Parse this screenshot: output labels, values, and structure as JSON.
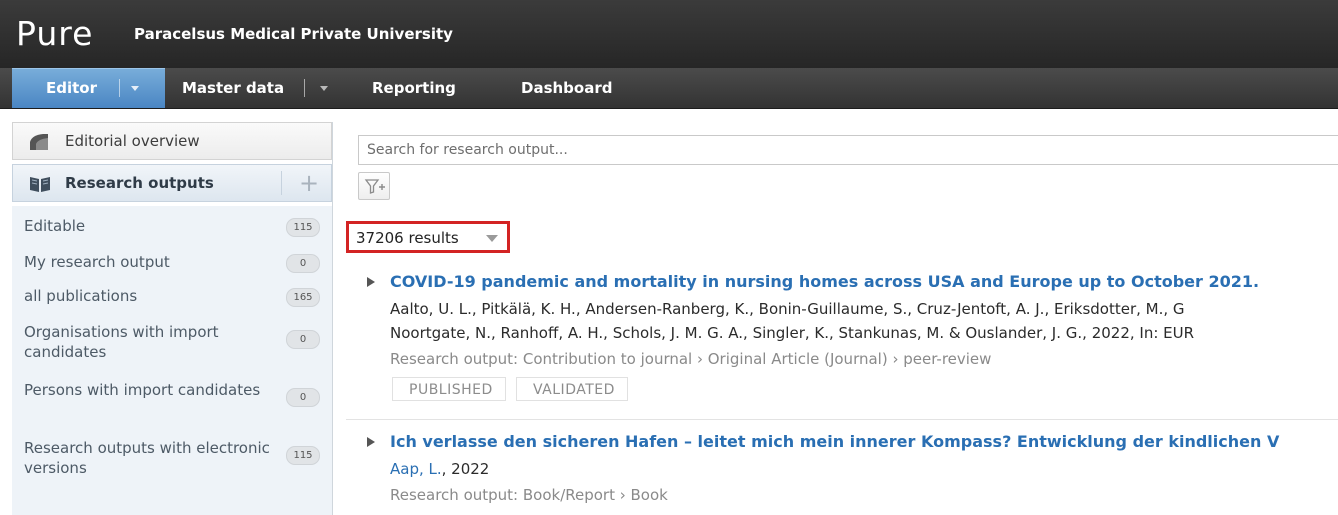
{
  "app": {
    "logo": "Pure",
    "organisation": "Paracelsus Medical Private University"
  },
  "nav": {
    "editor": "Editor",
    "master_data": "Master data",
    "reporting": "Reporting",
    "dashboard": "Dashboard"
  },
  "sidebar": {
    "overview": "Editorial overview",
    "research_outputs": "Research outputs",
    "items": [
      {
        "label": "Editable",
        "count": "115"
      },
      {
        "label": "My research output",
        "count": "0"
      },
      {
        "label": "all publications",
        "count": "165"
      },
      {
        "label": "Organisations with import candidates",
        "count": "0"
      },
      {
        "label": "Persons with import candidates",
        "count": "0"
      },
      {
        "label": "Research outputs with electronic versions",
        "count": "115"
      }
    ]
  },
  "main": {
    "search_placeholder": "Search for research output...",
    "results": "37206 results",
    "entries": [
      {
        "title": "COVID-19 pandemic and mortality in nursing homes across USA and Europe up to October 2021.",
        "authors_line1": "Aalto, U. L., Pitkälä, K. H., Andersen-Ranberg, K., Bonin-Guillaume, S., Cruz-Jentoft, A. J., Eriksdotter, M., G",
        "authors_line2": "Noortgate, N., Ranhoff, A. H., Schols, J. M. G. A., Singler, K., Stankunas, M. & Ouslander, J. G., 2022, In: EUR",
        "type": "Research output: Contribution to journal › Original Article (Journal) › peer-review",
        "tags": [
          "PUBLISHED",
          "VALIDATED"
        ]
      },
      {
        "title": "Ich verlasse den sicheren Hafen – leitet mich mein innerer Kompass? Entwicklung der kindlichen V",
        "author": "Aap, L.",
        "year": ", 2022",
        "type": "Research output: Book/Report › Book"
      }
    ]
  },
  "colors": {
    "accent": "#4a86c3",
    "link": "#2a6fb3",
    "highlight": "#d32323"
  }
}
